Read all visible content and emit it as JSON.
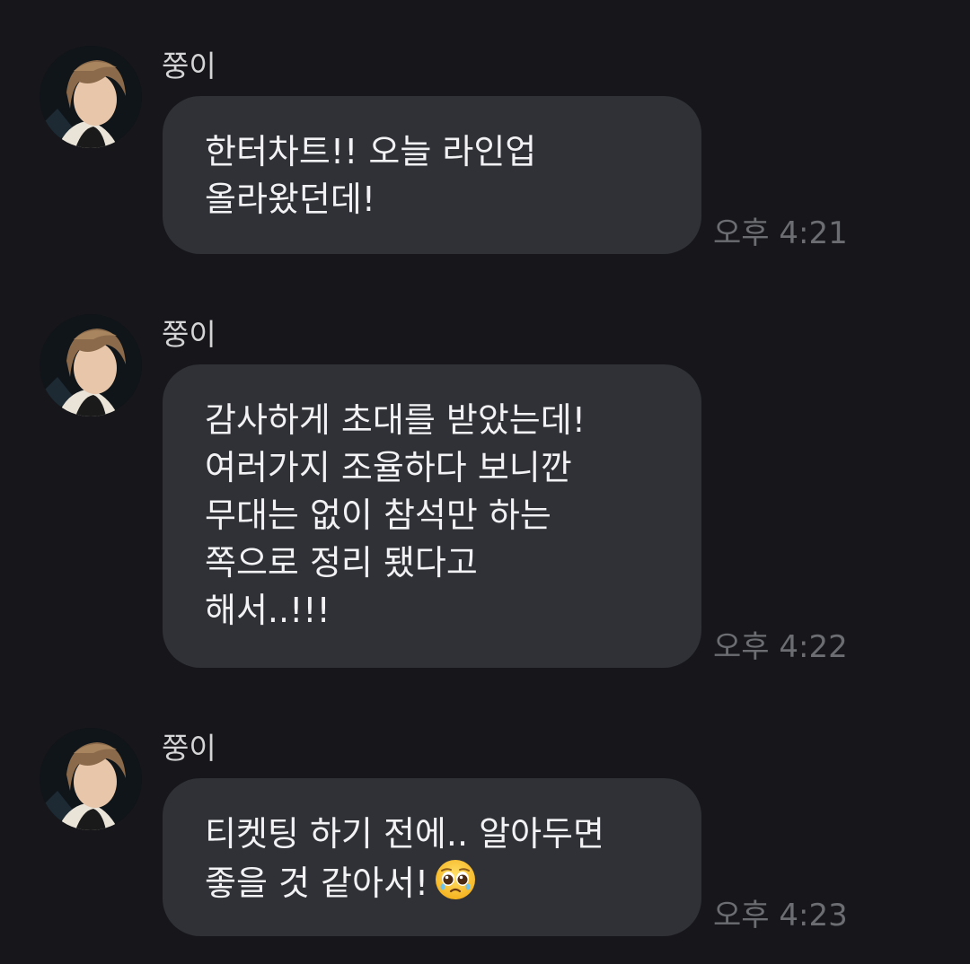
{
  "messages": [
    {
      "sender": "쭝이",
      "lines": [
        "한터차트!! 오늘 라인업",
        "올라왔던데!"
      ],
      "time": "오후 4:21"
    },
    {
      "sender": "쭝이",
      "lines": [
        "감사하게 초대를 받았는데!",
        "여러가지 조율하다 보니깐",
        "무대는 없이 참석만 하는",
        "쪽으로 정리 됐다고",
        "해서..!!!"
      ],
      "time": "오후 4:22"
    },
    {
      "sender": "쭝이",
      "lines": [
        "티켓팅 하기 전에.. 알아두면",
        "좋을 것 같아서!"
      ],
      "time": "오후 4:23",
      "emoji": "pleading-face-emoji"
    }
  ],
  "colors": {
    "background": "#17171b",
    "bubble": "#2f3137",
    "text": "#f2f2f4",
    "sender": "#d4d4d6",
    "time": "#6b6d72"
  }
}
